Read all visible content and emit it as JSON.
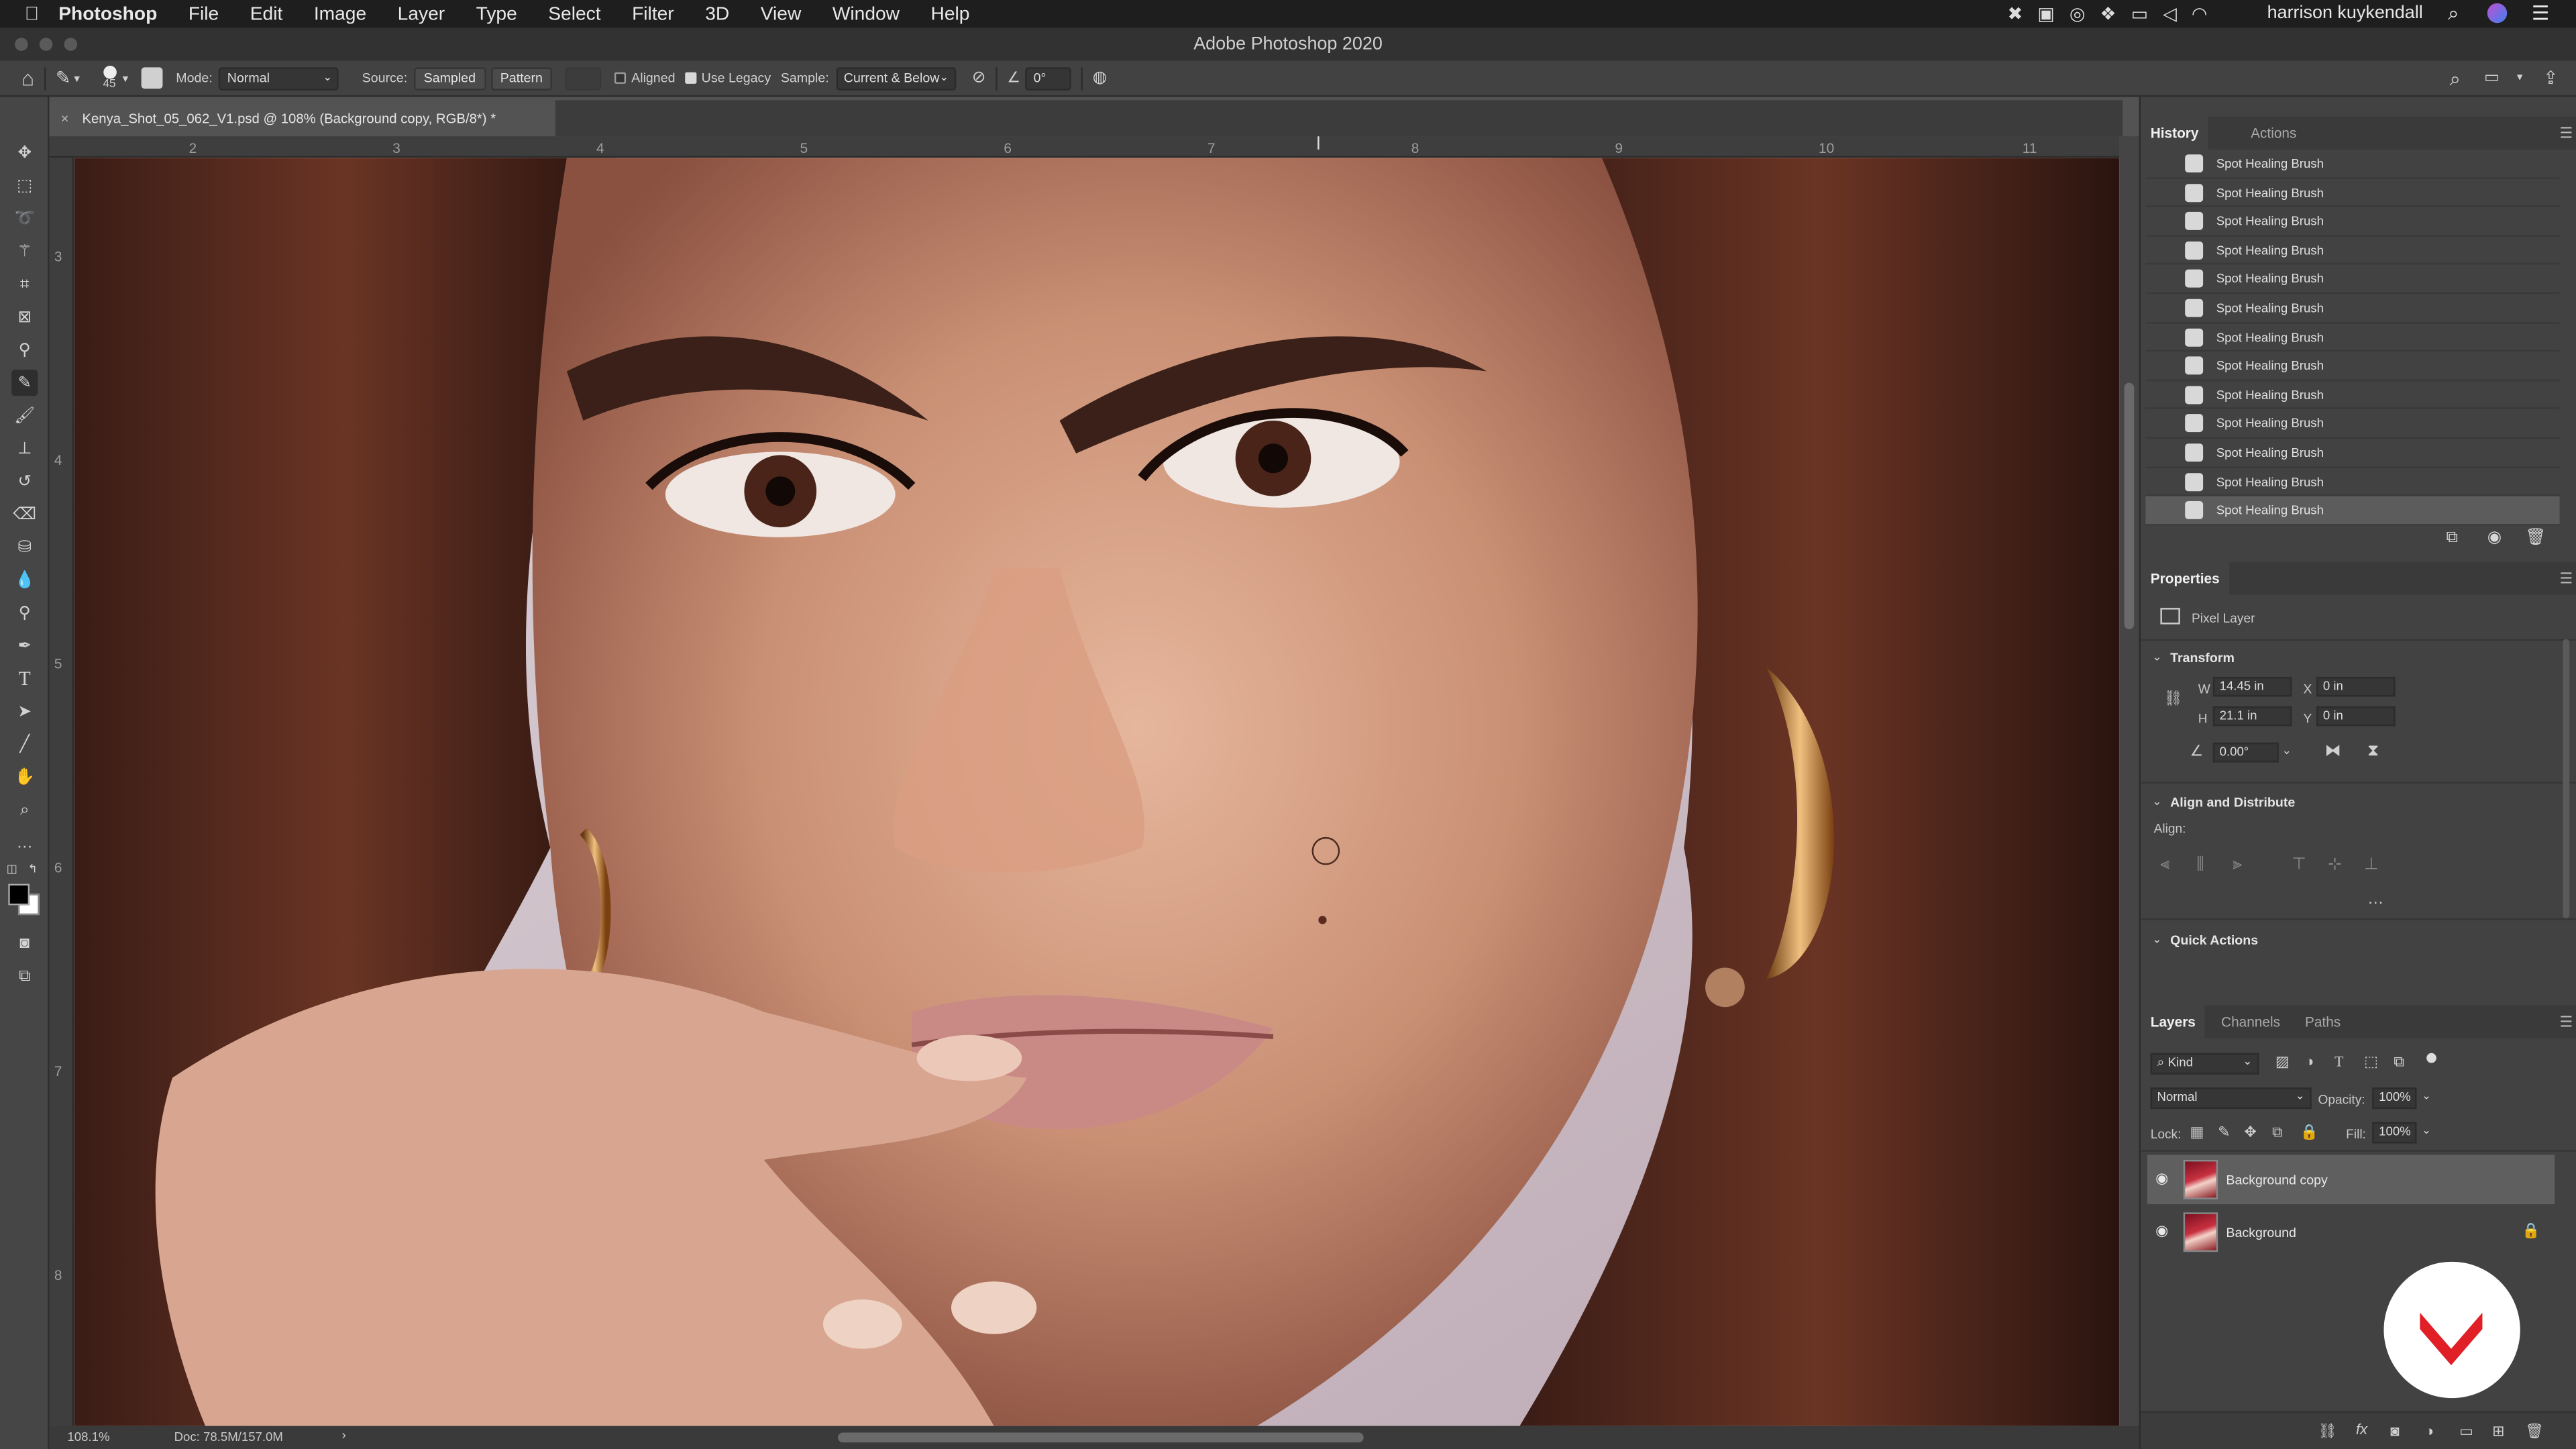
{
  "menubar": {
    "apple_icon": "apple-icon",
    "app_name": "Photoshop",
    "items": [
      "File",
      "Edit",
      "Image",
      "Layer",
      "Type",
      "Select",
      "Filter",
      "3D",
      "View",
      "Window",
      "Help"
    ],
    "user_name": "harrison kuykendall"
  },
  "window": {
    "title": "Adobe Photoshop 2020"
  },
  "options_bar": {
    "brush_size": "45",
    "mode_label": "Mode:",
    "mode_value": "Normal",
    "source_label": "Source:",
    "source_sampled": "Sampled",
    "source_pattern": "Pattern",
    "aligned_label": "Aligned",
    "aligned_checked": false,
    "use_legacy_label": "Use Legacy",
    "use_legacy_checked": true,
    "sample_label": "Sample:",
    "sample_value": "Current & Below",
    "angle_value": "0°"
  },
  "document": {
    "tab_title": "Kenya_Shot_05_062_V1.psd @ 108% (Background copy, RGB/8*) *",
    "zoom": "108.1%",
    "doc_size": "Doc: 78.5M/157.0M"
  },
  "rulers": {
    "top": [
      "2",
      "3",
      "4",
      "5",
      "6",
      "7",
      "8",
      "9",
      "10",
      "11"
    ],
    "left": [
      "3",
      "4",
      "5",
      "6",
      "7",
      "8"
    ]
  },
  "history": {
    "tabs": [
      "History",
      "Actions"
    ],
    "items": [
      "Spot Healing Brush",
      "Spot Healing Brush",
      "Spot Healing Brush",
      "Spot Healing Brush",
      "Spot Healing Brush",
      "Spot Healing Brush",
      "Spot Healing Brush",
      "Spot Healing Brush",
      "Spot Healing Brush",
      "Spot Healing Brush",
      "Spot Healing Brush",
      "Spot Healing Brush",
      "Spot Healing Brush"
    ]
  },
  "properties": {
    "title": "Properties",
    "layer_type": "Pixel Layer",
    "transform_title": "Transform",
    "w_label": "W",
    "w_value": "14.45 in",
    "h_label": "H",
    "h_value": "21.1 in",
    "x_label": "X",
    "x_value": "0 in",
    "y_label": "Y",
    "y_value": "0 in",
    "angle_value": "0.00°",
    "align_title": "Align and Distribute",
    "align_label": "Align:",
    "quick_actions_title": "Quick Actions"
  },
  "layers": {
    "tabs": [
      "Layers",
      "Channels",
      "Paths"
    ],
    "filter_kind": "Kind",
    "blend_mode": "Normal",
    "opacity_label": "Opacity:",
    "opacity_value": "100%",
    "lock_label": "Lock:",
    "fill_label": "Fill:",
    "fill_value": "100%",
    "items": [
      {
        "name": "Background copy",
        "selected": true,
        "visible": true,
        "locked": false
      },
      {
        "name": "Background",
        "selected": false,
        "visible": true,
        "locked": true
      }
    ]
  },
  "colors": {
    "accent_logo": "#e01f26"
  }
}
